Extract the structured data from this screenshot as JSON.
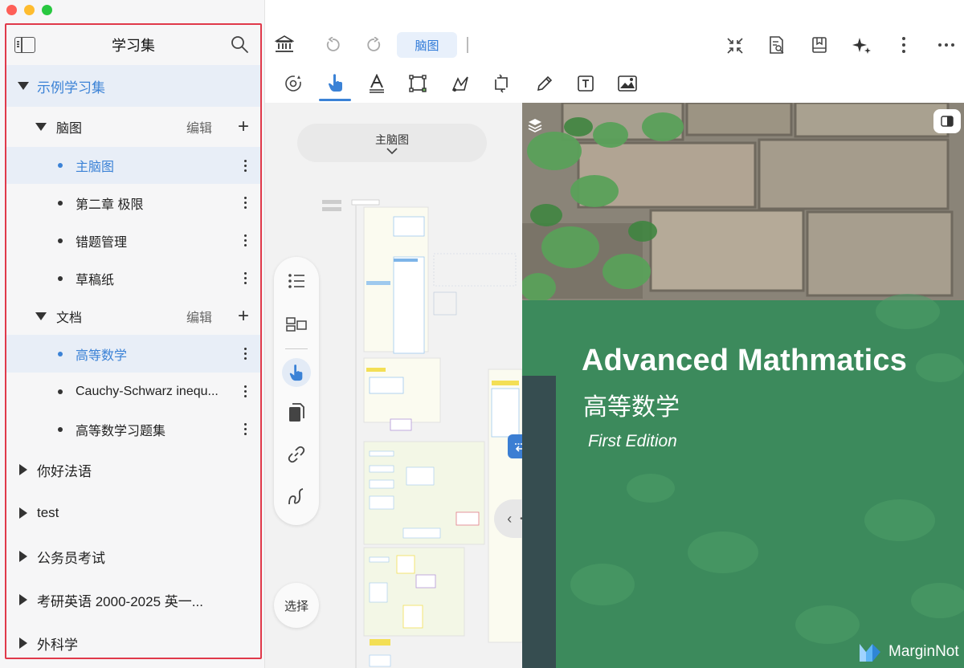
{
  "sidebar": {
    "title": "学习集",
    "edit_label": "编辑",
    "groups": [
      {
        "label": "示例学习集"
      },
      {
        "label": "脑图"
      },
      {
        "label": "文档"
      }
    ],
    "mindmap_items": [
      "主脑图",
      "第二章 极限",
      "错题管理",
      "草稿纸"
    ],
    "document_items": [
      "高等数学",
      "Cauchy-Schwarz inequ...",
      "高等数学习题集"
    ],
    "collections": [
      "你好法语",
      "test",
      "公务员考试",
      "考研英语 2000-2025 英一...",
      "外科学"
    ]
  },
  "toolbar": {
    "tab_mindmap": "脑图"
  },
  "mindmap": {
    "title": "主脑图",
    "select_label": "选择"
  },
  "document": {
    "title_en": "Advanced Mathmatics",
    "title_cn": "高等数学",
    "edition": "First Edition",
    "brand": "MarginNot"
  },
  "colors": {
    "accent": "#3b82d6",
    "selection": "#e8eef7",
    "highlight_frame": "#e0394a",
    "cover_green": "#3e8a5e"
  }
}
